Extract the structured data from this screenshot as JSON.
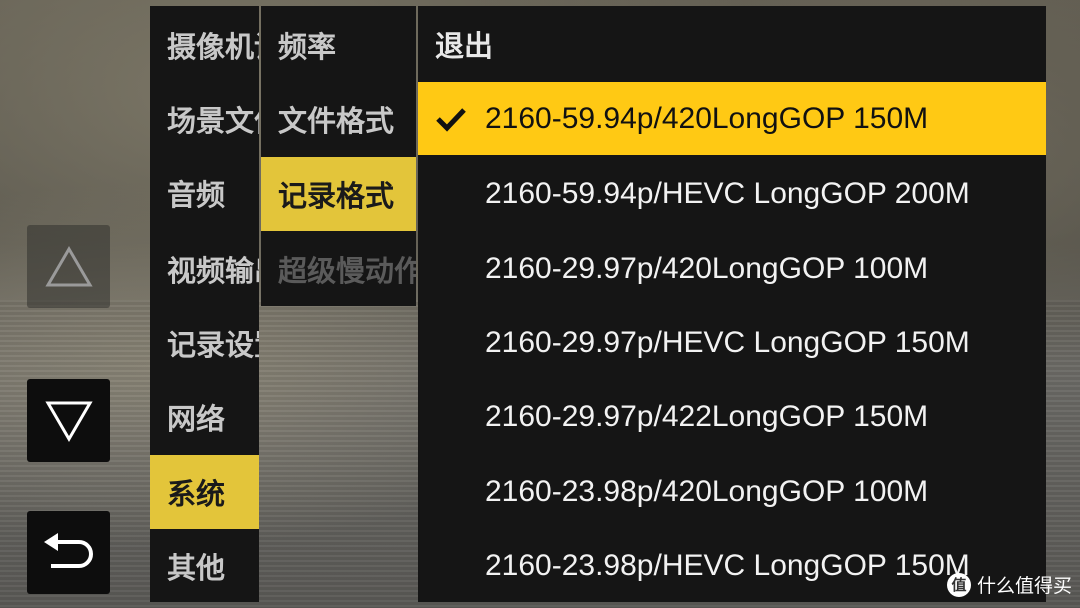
{
  "nav": {
    "up_icon": "triangle-up-outline-icon",
    "down_icon": "triangle-down-outline-icon",
    "back_icon": "return-arrow-icon"
  },
  "menu_main": {
    "items": [
      {
        "label": "摄像机设置",
        "active": false
      },
      {
        "label": "场景文件",
        "active": false
      },
      {
        "label": "音频",
        "active": false
      },
      {
        "label": "视频输出",
        "active": false
      },
      {
        "label": "记录设置",
        "active": false
      },
      {
        "label": "网络",
        "active": false
      },
      {
        "label": "系统",
        "active": true
      },
      {
        "label": "其他",
        "active": false
      }
    ]
  },
  "menu_sub": {
    "items": [
      {
        "label": "频率",
        "active": false,
        "disabled": false
      },
      {
        "label": "文件格式",
        "active": false,
        "disabled": false
      },
      {
        "label": "记录格式",
        "active": true,
        "disabled": false
      },
      {
        "label": "超级慢动作",
        "active": false,
        "disabled": true
      }
    ]
  },
  "menu_options": {
    "exit_label": "退出",
    "items": [
      {
        "label": "2160-59.94p/420LongGOP 150M",
        "selected": true
      },
      {
        "label": "2160-59.94p/HEVC LongGOP 200M",
        "selected": false
      },
      {
        "label": "2160-29.97p/420LongGOP 100M",
        "selected": false
      },
      {
        "label": "2160-29.97p/HEVC LongGOP 150M",
        "selected": false
      },
      {
        "label": "2160-29.97p/422LongGOP 150M",
        "selected": false
      },
      {
        "label": "2160-23.98p/420LongGOP 100M",
        "selected": false
      },
      {
        "label": "2160-23.98p/HEVC LongGOP 150M",
        "selected": false
      }
    ]
  },
  "watermark": {
    "logo_glyph": "值",
    "text": "什么值得买"
  },
  "colors": {
    "highlight_yellow": "#ffc914",
    "menu_active": "#e3c53a",
    "panel_bg": "#151515"
  }
}
